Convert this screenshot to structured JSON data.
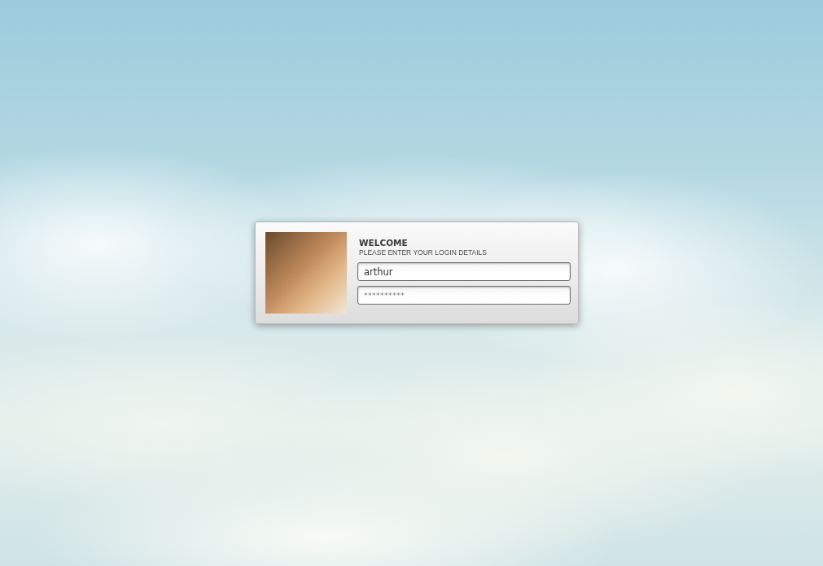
{
  "login": {
    "title": "WELCOME",
    "subtitle": "PLEASE ENTER YOUR LOGIN DETAILS",
    "username": {
      "value": "arthur"
    },
    "password": {
      "value": "**********"
    }
  }
}
